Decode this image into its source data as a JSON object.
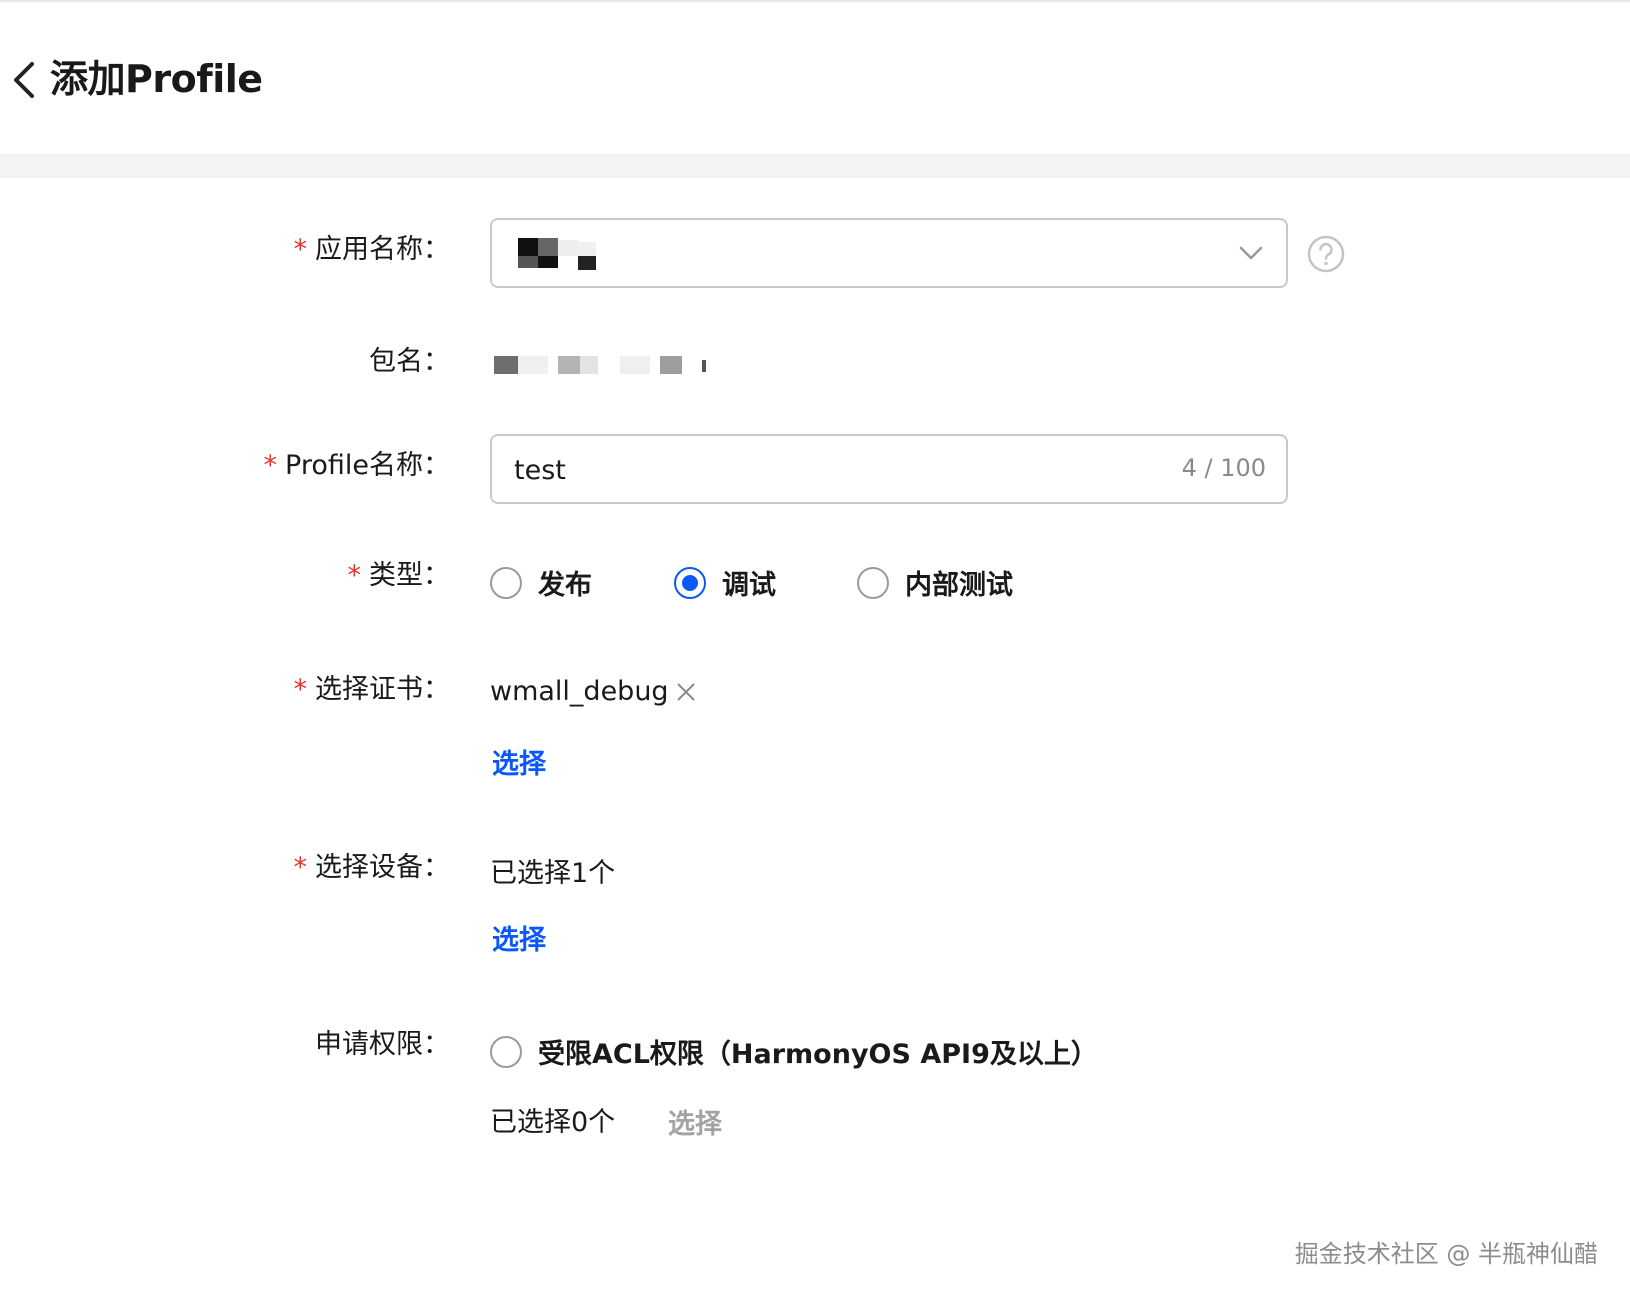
{
  "header": {
    "title": "添加Profile",
    "back_icon": "chevron-left-icon"
  },
  "form": {
    "app_name": {
      "required_mark": "*",
      "label": "应用名称：",
      "dropdown_icon": "chevron-down-icon",
      "help_icon": "question-circle-icon"
    },
    "package_name": {
      "label": "包名："
    },
    "profile_name": {
      "required_mark": "*",
      "label": "Profile名称：",
      "value": "test",
      "counter": "4 / 100"
    },
    "type": {
      "required_mark": "*",
      "label": "类型：",
      "options": [
        {
          "label": "发布",
          "checked": false
        },
        {
          "label": "调试",
          "checked": true
        },
        {
          "label": "内部测试",
          "checked": false
        }
      ]
    },
    "certificate": {
      "required_mark": "*",
      "label": "选择证书：",
      "selected": "wmall_debug",
      "remove_icon": "close-icon",
      "select_link": "选择"
    },
    "device": {
      "required_mark": "*",
      "label": "选择设备：",
      "status": "已选择1个",
      "select_link": "选择"
    },
    "permission": {
      "label": "申请权限：",
      "option_label": "受限ACL权限（HarmonyOS API9及以上）",
      "option_checked": false,
      "status": "已选择0个",
      "select_link": "选择"
    }
  },
  "watermark": "掘金技术社区 @ 半瓶神仙醋",
  "colors": {
    "primary": "#0a59f7",
    "required": "#e8352e",
    "disabled": "#a3a3a3"
  }
}
